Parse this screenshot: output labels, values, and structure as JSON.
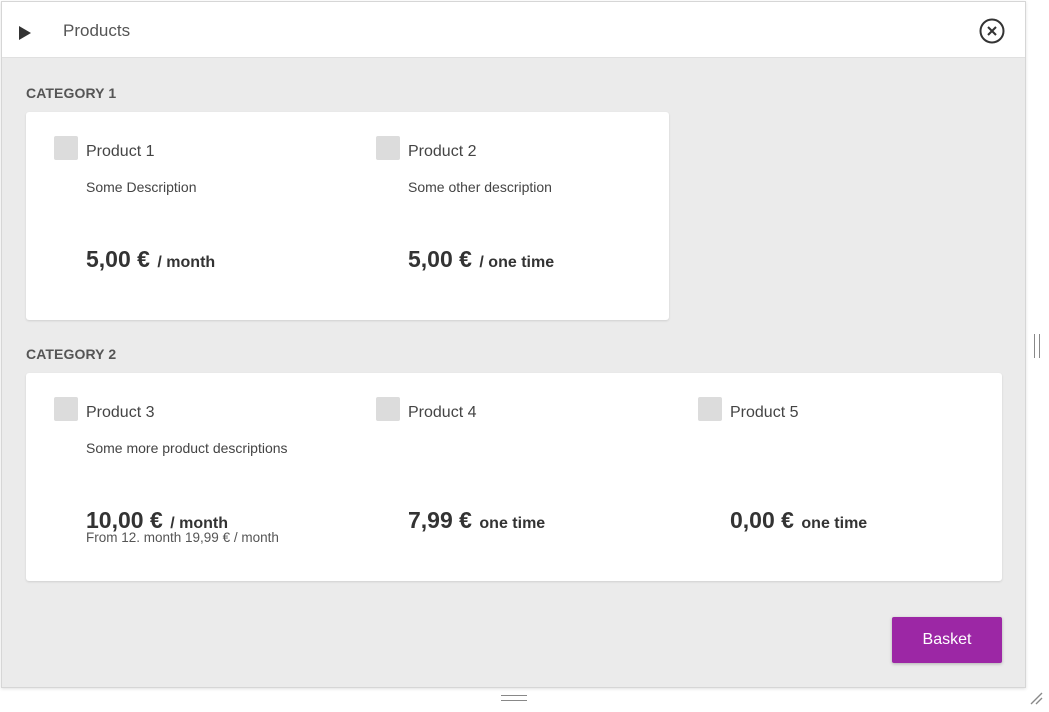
{
  "window": {
    "title": "Products"
  },
  "categories": [
    {
      "label": "CATEGORY 1",
      "products": [
        {
          "name": "Product 1",
          "description": "Some Description",
          "amount": "5,00 €",
          "period": "/ month",
          "note": ""
        },
        {
          "name": "Product 2",
          "description": "Some other description",
          "amount": "5,00 €",
          "period": "/ one time",
          "note": ""
        }
      ]
    },
    {
      "label": "CATEGORY 2",
      "products": [
        {
          "name": "Product 3",
          "description": "Some more product descriptions",
          "amount": "10,00 €",
          "period": "/ month",
          "note": "From 12. month 19,99 € / month"
        },
        {
          "name": "Product 4",
          "description": "",
          "amount": "7,99 €",
          "period": "one time",
          "note": ""
        },
        {
          "name": "Product 5",
          "description": "",
          "amount": "0,00 €",
          "period": "one time",
          "note": ""
        }
      ]
    }
  ],
  "footer": {
    "basket_label": "Basket"
  },
  "colors": {
    "accent": "#9c27a5",
    "background": "#ebebeb",
    "card": "#ffffff"
  },
  "icons": {
    "expand": "play-icon",
    "close": "close-circle-icon"
  }
}
